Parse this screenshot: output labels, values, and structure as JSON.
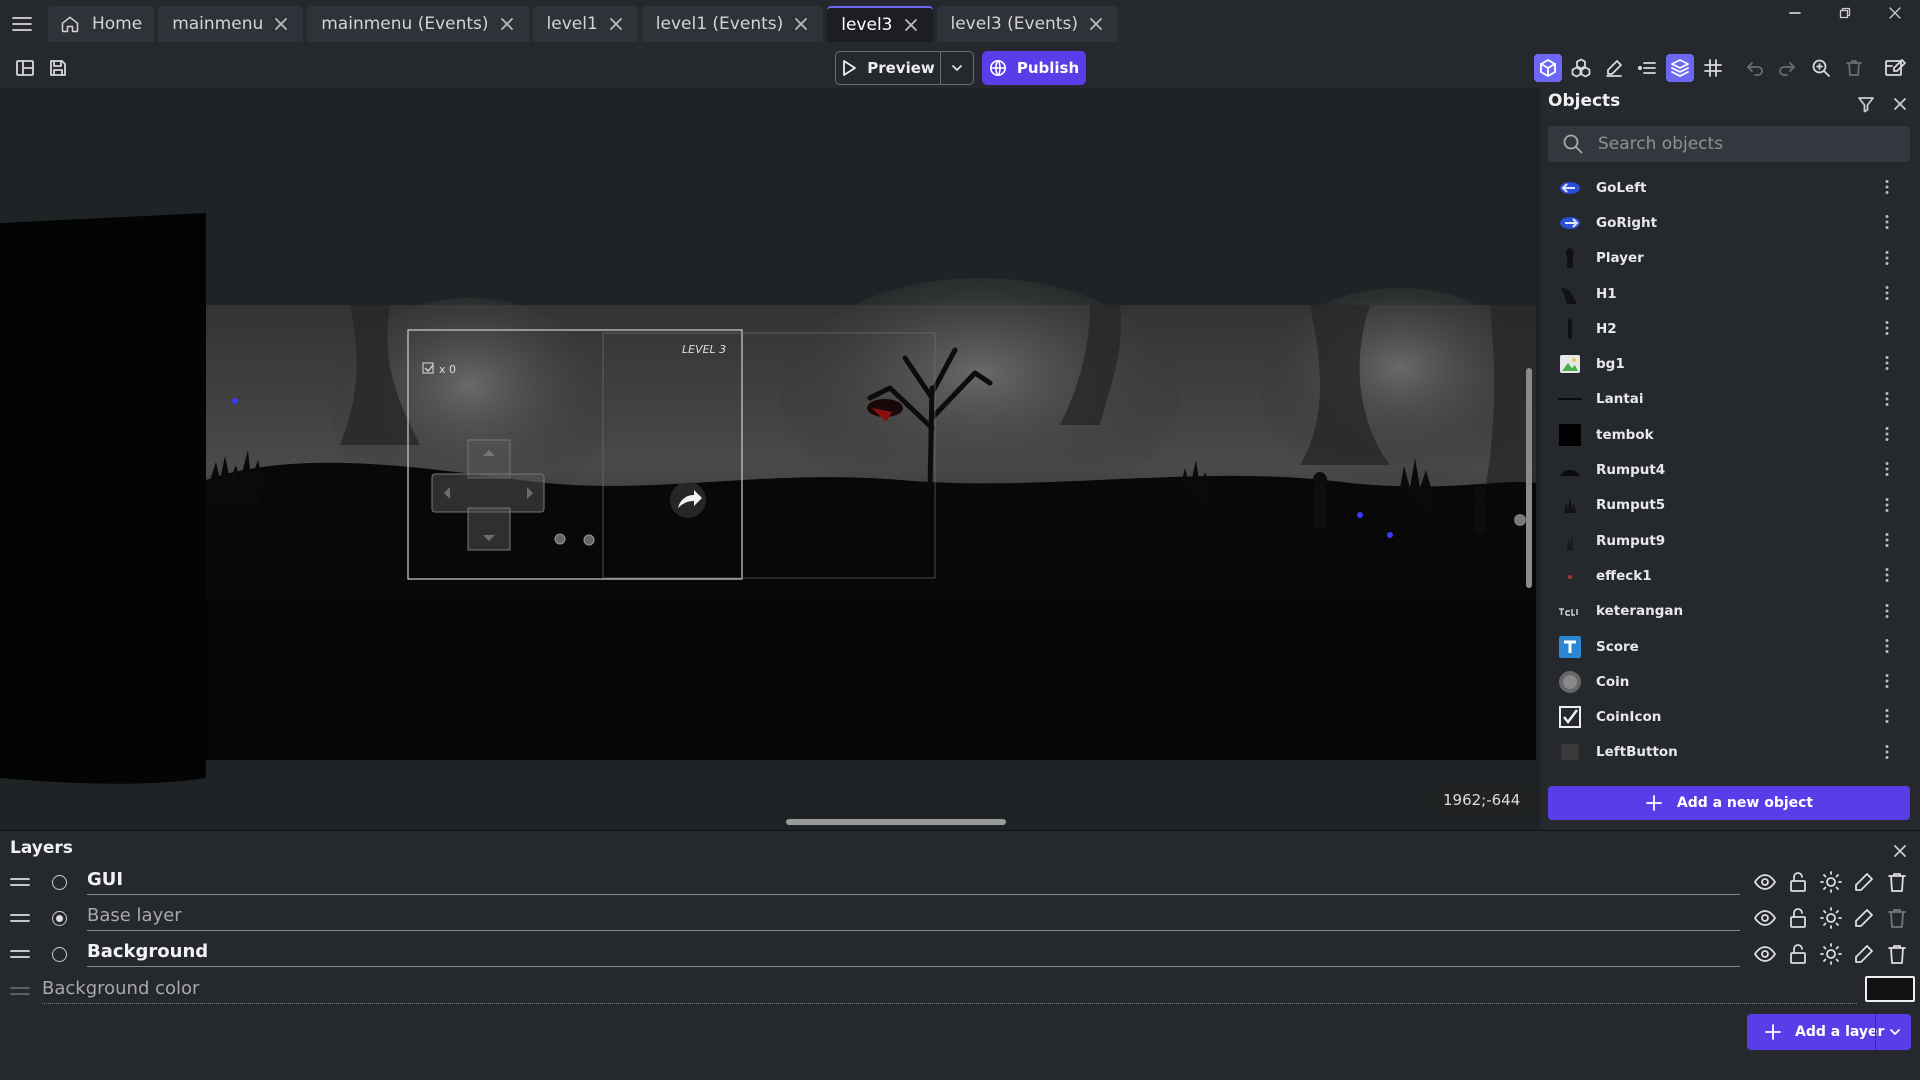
{
  "tabs": [
    {
      "label": "Home",
      "active": false,
      "closable": false
    },
    {
      "label": "mainmenu",
      "active": false,
      "closable": true
    },
    {
      "label": "mainmenu (Events)",
      "active": false,
      "closable": true
    },
    {
      "label": "level1",
      "active": false,
      "closable": true
    },
    {
      "label": "level1 (Events)",
      "active": false,
      "closable": true
    },
    {
      "label": "level3",
      "active": true,
      "closable": true
    },
    {
      "label": "level3 (Events)",
      "active": false,
      "closable": true
    }
  ],
  "toolbar": {
    "preview_label": "Preview",
    "publish_label": "Publish",
    "accent": "#5a3de8"
  },
  "scene": {
    "coords": "1962;-644",
    "hud_count": "x 0",
    "hud_level": "LEVEL 3"
  },
  "objects_panel": {
    "title": "Objects",
    "search_placeholder": "Search objects",
    "items": [
      {
        "name": "GoLeft",
        "icon": "blue-arrow-left-icon"
      },
      {
        "name": "GoRight",
        "icon": "blue-arrow-right-icon"
      },
      {
        "name": "Player",
        "icon": "player-silhouette-icon"
      },
      {
        "name": "H1",
        "icon": "enemy-silhouette-icon"
      },
      {
        "name": "H2",
        "icon": "enemy-silhouette-icon"
      },
      {
        "name": "bg1",
        "icon": "image-icon"
      },
      {
        "name": "Lantai",
        "icon": "floor-line-icon"
      },
      {
        "name": "tembok",
        "icon": "wall-block-icon"
      },
      {
        "name": "Rumput4",
        "icon": "grass-icon"
      },
      {
        "name": "Rumput5",
        "icon": "grass-icon"
      },
      {
        "name": "Rumput9",
        "icon": "grass-icon"
      },
      {
        "name": "effeck1",
        "icon": "particle-icon"
      },
      {
        "name": "keterangan",
        "icon": "text-icon"
      },
      {
        "name": "Score",
        "icon": "text-box-icon"
      },
      {
        "name": "Coin",
        "icon": "coin-icon"
      },
      {
        "name": "CoinIcon",
        "icon": "checkbox-icon"
      },
      {
        "name": "LeftButton",
        "icon": "button-icon"
      }
    ],
    "add_label": "Add a new object"
  },
  "layers_panel": {
    "title": "Layers",
    "layers": [
      {
        "name": "GUI",
        "selected": false
      },
      {
        "name": "Base layer",
        "selected": true
      },
      {
        "name": "Background",
        "selected": false
      }
    ],
    "background_color_label": "Background color",
    "background_color": "#111111",
    "add_label": "Add a layer"
  }
}
